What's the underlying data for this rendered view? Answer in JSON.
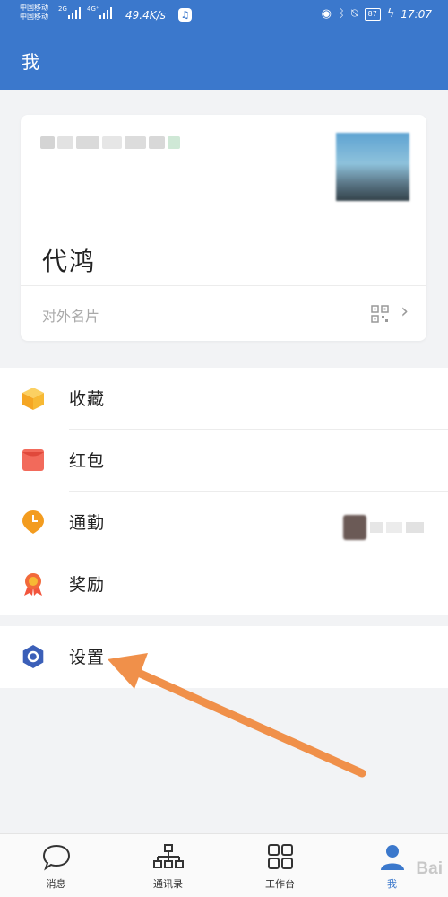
{
  "status_bar": {
    "carrier_1": "中国移动",
    "carrier_2": "中国移动",
    "net_type_1": "2G",
    "net_type_2": "4G⁺",
    "speed": "49.4K/s",
    "battery": "87",
    "time": "17:07"
  },
  "header": {
    "title": "我"
  },
  "card": {
    "name": "代鸿",
    "business_card_label": "对外名片"
  },
  "menu": {
    "items": [
      {
        "label": "收藏",
        "icon": "cube-icon",
        "color": "#f7b934"
      },
      {
        "label": "红包",
        "icon": "red-envelope-icon",
        "color": "#f26a5b"
      },
      {
        "label": "通勤",
        "icon": "clock-pin-icon",
        "color": "#f39c1f"
      },
      {
        "label": "奖励",
        "icon": "medal-icon",
        "color": "#f2553d"
      }
    ],
    "settings": {
      "label": "设置",
      "icon": "hexagon-gear-icon",
      "color": "#3b5fb8"
    }
  },
  "tabbar": {
    "tabs": [
      {
        "label": "消息",
        "icon": "chat-bubble-icon"
      },
      {
        "label": "通讯录",
        "icon": "org-chart-icon"
      },
      {
        "label": "工作台",
        "icon": "grid-icon"
      },
      {
        "label": "我",
        "icon": "person-icon"
      }
    ]
  },
  "watermark": "Bai",
  "colors": {
    "accent": "#3b78cc",
    "arrow": "#f0904a"
  }
}
